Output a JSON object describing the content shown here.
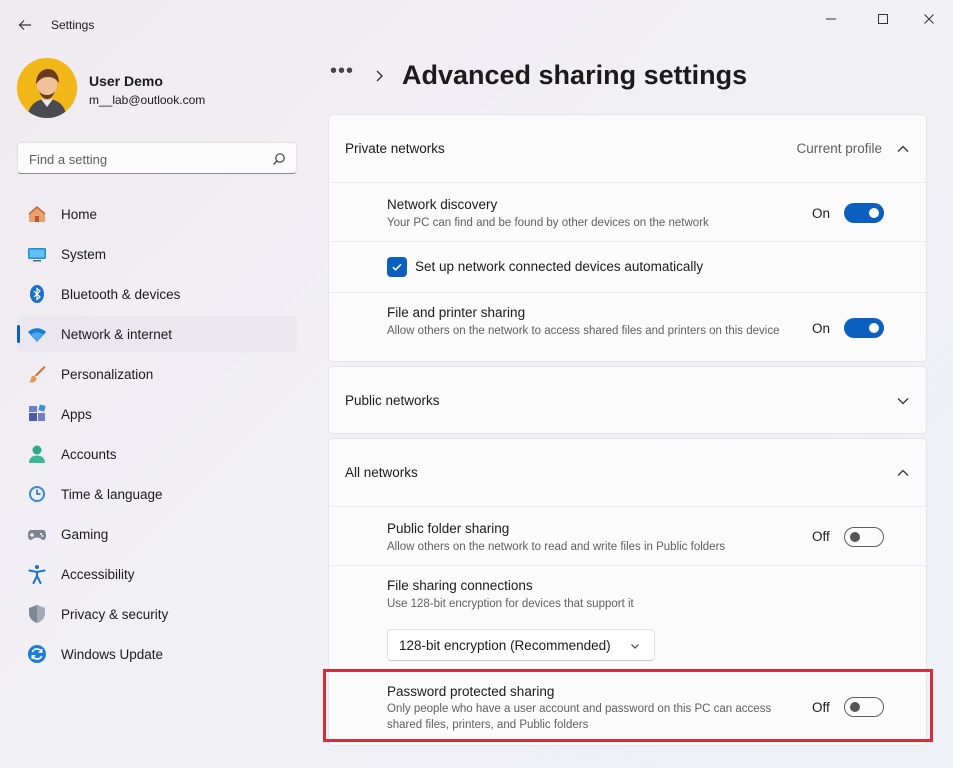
{
  "window": {
    "title": "Settings"
  },
  "profile": {
    "name": "User Demo",
    "email": "m__lab@outlook.com"
  },
  "search": {
    "placeholder": "Find a setting"
  },
  "nav": {
    "items": [
      {
        "label": "Home",
        "icon": "home-icon"
      },
      {
        "label": "System",
        "icon": "system-icon"
      },
      {
        "label": "Bluetooth & devices",
        "icon": "bluetooth-icon"
      },
      {
        "label": "Network & internet",
        "icon": "wifi-icon",
        "active": true
      },
      {
        "label": "Personalization",
        "icon": "brush-icon"
      },
      {
        "label": "Apps",
        "icon": "apps-icon"
      },
      {
        "label": "Accounts",
        "icon": "accounts-icon"
      },
      {
        "label": "Time & language",
        "icon": "clock-globe-icon"
      },
      {
        "label": "Gaming",
        "icon": "gamepad-icon"
      },
      {
        "label": "Accessibility",
        "icon": "accessibility-icon"
      },
      {
        "label": "Privacy & security",
        "icon": "shield-icon"
      },
      {
        "label": "Windows Update",
        "icon": "update-icon"
      }
    ]
  },
  "breadcrumb": {
    "dots": "•••",
    "title": "Advanced sharing settings"
  },
  "private_networks": {
    "title": "Private networks",
    "note": "Current profile",
    "network_discovery": {
      "title": "Network discovery",
      "desc": "Your PC can find and be found by other devices on the network",
      "state": "On"
    },
    "auto_setup": {
      "label": "Set up network connected devices automatically",
      "checked": true
    },
    "file_printer_sharing": {
      "title": "File and printer sharing",
      "desc": "Allow others on the network to access shared files and printers on this device",
      "state": "On"
    }
  },
  "public_networks": {
    "title": "Public networks"
  },
  "all_networks": {
    "title": "All networks",
    "public_folder_sharing": {
      "title": "Public folder sharing",
      "desc": "Allow others on the network to read and write files in Public folders",
      "state": "Off"
    },
    "file_sharing_connections": {
      "title": "File sharing connections",
      "desc": "Use 128-bit encryption for devices that support it",
      "selected": "128-bit encryption (Recommended)"
    },
    "password_protected_sharing": {
      "title": "Password protected sharing",
      "desc": "Only people who have a user account and password on this PC can access shared files, printers, and Public folders",
      "state": "Off"
    }
  },
  "colors": {
    "accent": "#0a5fbf",
    "highlight": "#d32f3a"
  }
}
